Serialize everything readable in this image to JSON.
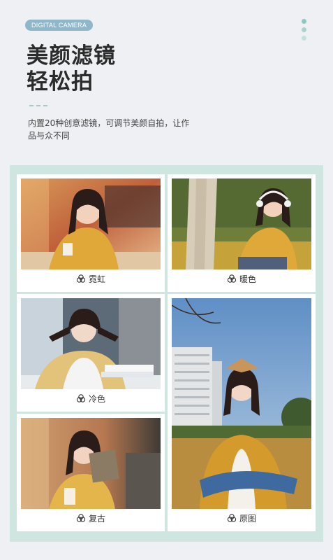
{
  "header": {
    "tag": "DIGITAL CAMERA",
    "title_line1": "美颜滤镜",
    "title_line2": "轻松拍",
    "description": "内置20种创意滤镜，可调节美颜自拍，让作品与众不同"
  },
  "filters": [
    {
      "label": "霓虹",
      "icon": "filter-circles-icon"
    },
    {
      "label": "暖色",
      "icon": "filter-circles-icon"
    },
    {
      "label": "冷色",
      "icon": "filter-circles-icon"
    },
    {
      "label": "复古",
      "icon": "filter-circles-icon"
    },
    {
      "label": "原图",
      "icon": "filter-circles-icon"
    }
  ],
  "colors": {
    "background": "#eef0f3",
    "panel": "#cfe5e0",
    "tag": "#8fb7c9",
    "dots": [
      "#8fc6c0",
      "#a7d3cd",
      "#c3e0dc"
    ]
  }
}
